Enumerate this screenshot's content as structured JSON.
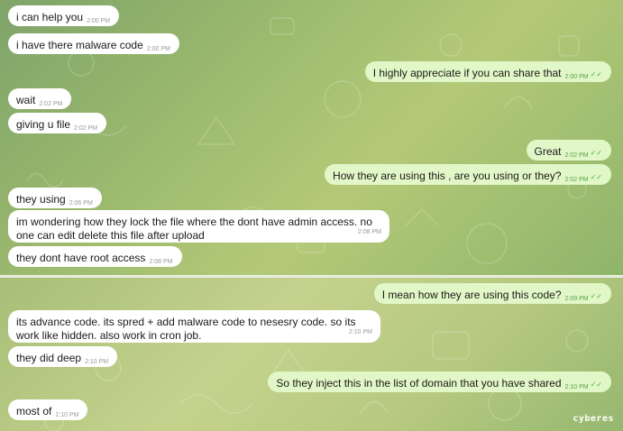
{
  "messages_top": [
    {
      "id": "m1",
      "side": "in",
      "text": "i can help you",
      "time": "2:00 PM"
    },
    {
      "id": "m2",
      "side": "in",
      "text": "i have there malware code",
      "time": "2:00 PM"
    },
    {
      "id": "m3",
      "side": "out",
      "text": "I highly appreciate if you can share that",
      "time": "2:00 PM"
    },
    {
      "id": "m4",
      "side": "in",
      "text": "wait",
      "time": "2:02 PM"
    },
    {
      "id": "m5",
      "side": "in",
      "text": "giving u file",
      "time": "2:02 PM"
    },
    {
      "id": "m6",
      "side": "out",
      "text": "Great",
      "time": "2:02 PM"
    },
    {
      "id": "m7",
      "side": "out",
      "text": "How they are using this , are you using or they?",
      "time": "2:02 PM"
    },
    {
      "id": "m8",
      "side": "in",
      "text": "they using",
      "time": "2:06 PM"
    },
    {
      "id": "m9",
      "side": "in",
      "text": "im wondering how they lock the file where the dont have admin access. no one can edit delete this file after upload",
      "time": "2:08 PM"
    },
    {
      "id": "m10",
      "side": "in",
      "text": "they dont have root access",
      "time": "2:08 PM"
    }
  ],
  "messages_bottom": [
    {
      "id": "m11",
      "side": "out",
      "text": "I mean how they are using this code?",
      "time": "2:09 PM"
    },
    {
      "id": "m12",
      "side": "in",
      "text": "its advance code. its spred + add malware code to nesesry code. so its work like hidden. also work in cron job.",
      "time": "2:10 PM"
    },
    {
      "id": "m13",
      "side": "in",
      "text": "they did deep",
      "time": "2:10 PM"
    },
    {
      "id": "m14",
      "side": "out",
      "text": "So they inject this in the list of domain that you have shared",
      "time": "2:10 PM"
    },
    {
      "id": "m15",
      "side": "in",
      "text": "most of",
      "time": "2:10 PM"
    }
  ],
  "read_ticks": "✓✓",
  "watermark": "cyberes",
  "colors": {
    "incoming": "#ffffff",
    "outgoing": "#e2f7c7",
    "tick": "#4fae4e",
    "wallpaper": "#9dbb6e"
  }
}
